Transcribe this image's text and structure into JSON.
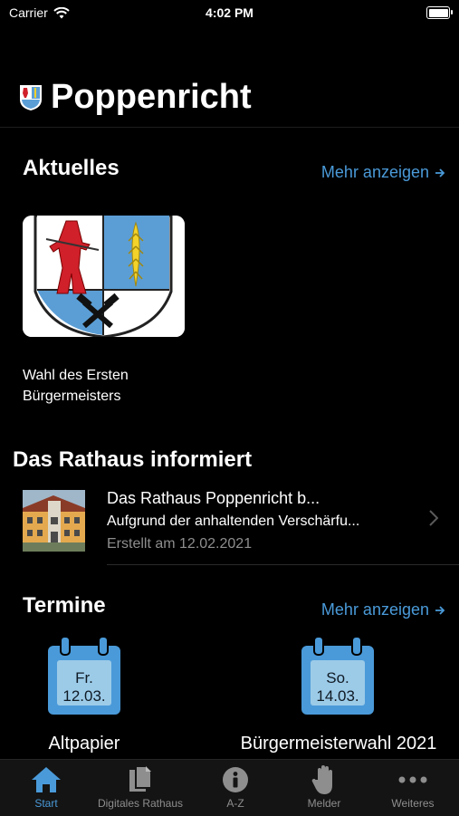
{
  "status_bar": {
    "carrier": "Carrier",
    "time": "4:02 PM"
  },
  "app": {
    "title": "Poppenricht"
  },
  "aktuelles": {
    "title": "Aktuelles",
    "more_label": "Mehr anzeigen",
    "items": [
      {
        "caption": "Wahl des Ersten Bürgermeisters"
      }
    ]
  },
  "rathaus": {
    "title": "Das Rathaus informiert",
    "items": [
      {
        "title": "Das Rathaus Poppenricht b...",
        "subtitle": "Aufgrund der anhaltenden Verschärfu...",
        "date": "Erstellt am 12.02.2021"
      }
    ]
  },
  "termine": {
    "title": "Termine",
    "more_label": "Mehr anzeigen",
    "events": [
      {
        "day": "Fr.",
        "date": "12.03.",
        "name": "Altpapier"
      },
      {
        "day": "So.",
        "date": "14.03.",
        "name": "Bürgermeisterwahl 2021"
      }
    ]
  },
  "tabbar": {
    "tabs": [
      {
        "label": "Start",
        "icon": "house-icon",
        "active": true
      },
      {
        "label": "Digitales Rathaus",
        "icon": "documents-icon"
      },
      {
        "label": "A-Z",
        "icon": "info-icon"
      },
      {
        "label": "Melder",
        "icon": "hand-icon"
      },
      {
        "label": "Weiteres",
        "icon": "more-icon"
      }
    ]
  },
  "colors": {
    "accent": "#4a9ad9",
    "background": "#000000",
    "secondary_text": "#8e8e8e"
  }
}
